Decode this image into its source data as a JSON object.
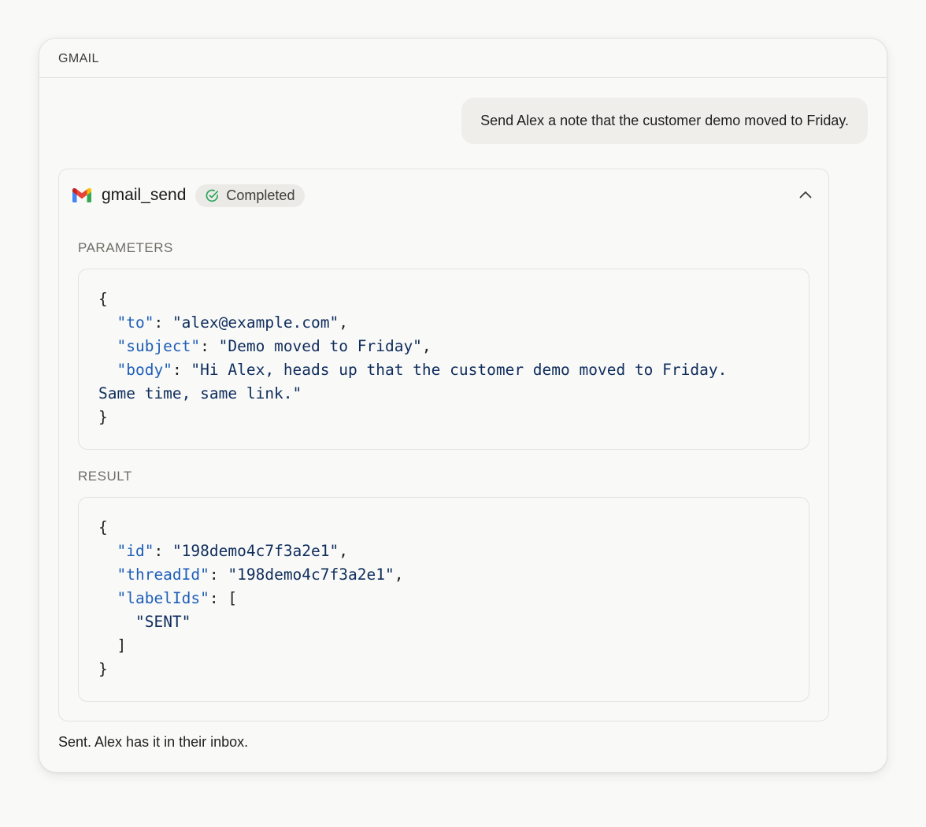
{
  "card": {
    "title": "GMAIL"
  },
  "user_message": "Send Alex a note that the customer demo moved to Friday.",
  "tool_call": {
    "icon": "gmail-icon",
    "name": "gmail_send",
    "status": "Completed",
    "status_icon": "check-circle-icon",
    "status_color": "#22a355",
    "collapse_icon": "chevron-up-icon",
    "parameters_label": "PARAMETERS",
    "parameters": {
      "to_key": "\"to\"",
      "to_value": "\"alex@example.com\"",
      "subject_key": "\"subject\"",
      "subject_value": "\"Demo moved to Friday\"",
      "body_key": "\"body\"",
      "body_value_line1": "\"Hi Alex, heads up that the customer demo moved to Friday.",
      "body_value_line2": "Same time, same link.\""
    },
    "result_label": "RESULT",
    "result": {
      "id_key": "\"id\"",
      "id_value": "\"198demo4c7f3a2e1\"",
      "threadId_key": "\"threadId\"",
      "threadId_value": "\"198demo4c7f3a2e1\"",
      "labelIds_key": "\"labelIds\"",
      "labelIds_values": [
        "\"SENT\""
      ]
    }
  },
  "assistant_reply": "Sent. Alex has it in their inbox.",
  "colors": {
    "json_key": "#1f5fb8",
    "json_string": "#0f2d5c",
    "gmail_red": "#ea4335",
    "gmail_blue": "#4285f4",
    "gmail_green": "#34a853",
    "gmail_yellow": "#fbbc04"
  }
}
